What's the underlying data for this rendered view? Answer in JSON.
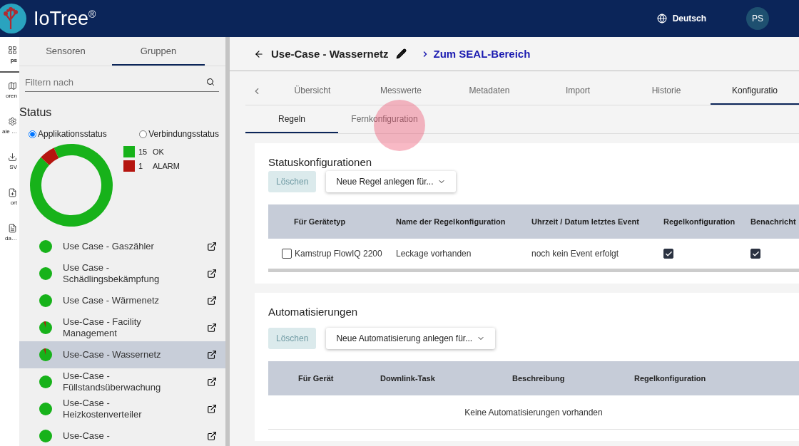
{
  "header": {
    "brand": "IoTree$^{®}$",
    "language": "Deutsch",
    "avatar": "PS"
  },
  "rail": [
    {
      "label": "ps",
      "selected": true
    },
    {
      "label": "oren",
      "selected": false
    },
    {
      "label": "ale …",
      "selected": false
    },
    {
      "label": "SV",
      "selected": false
    },
    {
      "label": "ort",
      "selected": false
    },
    {
      "label": "da…",
      "selected": false
    }
  ],
  "sidebar": {
    "tabs": [
      {
        "label": "Sensoren",
        "selected": false
      },
      {
        "label": "Gruppen",
        "selected": true
      }
    ],
    "filter": {
      "placeholder": "Filtern nach"
    },
    "status_title": "Status",
    "radios": [
      {
        "label": "Applikationsstatus",
        "selected": true
      },
      {
        "label": "Verbindungsstatus",
        "selected": false
      }
    ],
    "chart_data": {
      "type": "donut",
      "categories": [
        "OK",
        "ALARM"
      ],
      "values": [
        93.75,
        6.25
      ]
    },
    "legend": [
      {
        "count": "15",
        "color": "#17b21a"
      },
      {
        "count": "1",
        "color": "#b5150f"
      }
    ],
    "groups": [
      {
        "name": "Use Case - Gaszähler",
        "kind": "ok",
        "selected": false
      },
      {
        "name": "Use Case - Schädlingsbekämpfung",
        "kind": "ok",
        "selected": false
      },
      {
        "name": "Use Case - Wärmenetz",
        "kind": "ok",
        "selected": false
      },
      {
        "name": "Use-Case - Facility Management",
        "kind": "mixed",
        "selected": false
      },
      {
        "name": "Use-Case - Wassernetz",
        "kind": "mixed",
        "selected": true
      },
      {
        "name": "Use-Case - Füllstandsüberwachung",
        "kind": "ok",
        "selected": false
      },
      {
        "name": "Use-Case - Heizkostenverteiler",
        "kind": "ok",
        "selected": false
      },
      {
        "name": "Use-Case -",
        "kind": "ok",
        "selected": false
      }
    ]
  },
  "page": {
    "title": "Use-Case - Wassernetz",
    "link": "Zum SEAL-Bereich",
    "tabs": [
      {
        "label": "Übersicht",
        "selected": false
      },
      {
        "label": "Messwerte",
        "selected": false
      },
      {
        "label": "Metadaten",
        "selected": false
      },
      {
        "label": "Import",
        "selected": false
      },
      {
        "label": "Historie",
        "selected": false
      },
      {
        "label": "Konfiguratio",
        "selected": true
      }
    ],
    "subtabs": [
      {
        "label": "Regeln",
        "selected": true
      },
      {
        "label": "Fernkonfiguration",
        "selected": false
      }
    ],
    "status_config": {
      "title": "Statuskonfigurationen",
      "delete": "Löschen",
      "delete_disabled": true,
      "add": "Neue Regel anlegen für...",
      "columns": [
        "Für Gerätetyp",
        "Name der Regelkonfiguration",
        "Uhrzeit / Datum letztes Event",
        "Regelkonfiguration",
        "Benachricht"
      ],
      "rows": [
        {
          "checked": false,
          "device": "Kamstrup FlowIQ 2200",
          "name": "Leckage vorhanden",
          "last_event": "noch kein Event erfolgt",
          "rule_on": true,
          "notify_on": true
        }
      ]
    },
    "automations": {
      "title": "Automatisierungen",
      "delete": "Löschen",
      "delete_disabled": true,
      "add": "Neue Automatisierung anlegen für...",
      "columns": [
        "Für Gerät",
        "Downlink-Task",
        "Beschreibung",
        "Regelkonfiguration"
      ],
      "empty": "Keine Automatisierungen vorhanden"
    }
  }
}
